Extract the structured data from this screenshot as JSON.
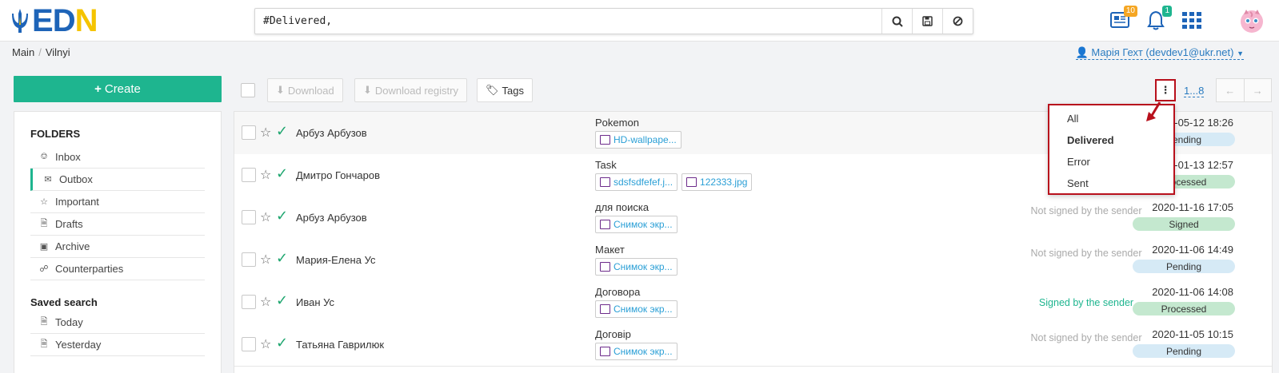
{
  "header": {
    "logo_text": "EDIN",
    "search_value": "#Delivered,",
    "notification_badges": {
      "documents": "10",
      "bell": "1"
    }
  },
  "breadcrumbs": [
    "Main",
    "Vilnyi"
  ],
  "user": {
    "label": "Марія Гехт (devdev1@ukr.net)"
  },
  "sidebar": {
    "create_label": "Create",
    "folders_title": "FOLDERS",
    "folders": [
      {
        "label": "Inbox",
        "icon": "inbox-icon"
      },
      {
        "label": "Outbox",
        "icon": "envelope-icon"
      },
      {
        "label": "Important",
        "icon": "star-icon"
      },
      {
        "label": "Drafts",
        "icon": "file-icon"
      },
      {
        "label": "Archive",
        "icon": "archive-icon"
      },
      {
        "label": "Counterparties",
        "icon": "handshake-icon"
      }
    ],
    "saved_title": "Saved search",
    "saved": [
      {
        "label": "Today",
        "icon": "file-icon"
      },
      {
        "label": "Yesterday",
        "icon": "file-icon"
      }
    ]
  },
  "toolbar": {
    "download_label": "Download",
    "download_registry_label": "Download registry",
    "tags_label": "Tags",
    "pager_label": "1...8"
  },
  "dropdown": {
    "items": [
      "All",
      "Delivered",
      "Error",
      "Sent"
    ],
    "selected": "Delivered"
  },
  "documents": [
    {
      "name": "Арбуз Арбузов",
      "subject": "Pokemon",
      "attachments": [
        "HD-wallpape..."
      ],
      "signature": "",
      "date": "2022-05-12",
      "time": "18:26",
      "status": "Pending"
    },
    {
      "name": "Дмитро Гончаров",
      "subject": "Task",
      "attachments": [
        "sdsfsdfefef.j...",
        "122333.jpg"
      ],
      "signature": "",
      "date": "2021-01-13",
      "time": "12:57",
      "status": "Processed"
    },
    {
      "name": "Арбуз Арбузов",
      "subject": "для поиска",
      "attachments": [
        "Снимок экр..."
      ],
      "signature": "Not signed by the sender",
      "date": "2020-11-16",
      "time": "17:05",
      "status": "Signed"
    },
    {
      "name": "Мария-Елена Ус",
      "subject": "Макет",
      "attachments": [
        "Снимок экр..."
      ],
      "signature": "Not signed by the sender",
      "date": "2020-11-06",
      "time": "14:49",
      "status": "Pending"
    },
    {
      "name": "Иван Ус",
      "subject": "Договора",
      "attachments": [
        "Снимок экр..."
      ],
      "signature": "Signed by the sender",
      "date": "2020-11-06",
      "time": "14:08",
      "status": "Processed"
    },
    {
      "name": "Татьяна Гаврилюк",
      "subject": "Договір",
      "attachments": [
        "Снимок экр..."
      ],
      "signature": "Not signed by the sender",
      "date": "2020-11-05",
      "time": "10:15",
      "status": "Pending"
    }
  ],
  "status_colors": {
    "Pending": "#d6eaf6",
    "Processed": "#c4e8cf",
    "Signed": "#c4e8cf"
  },
  "colors": {
    "accent": "#1eb58f",
    "link": "#2a7bc0",
    "highlight": "#b8101c"
  }
}
